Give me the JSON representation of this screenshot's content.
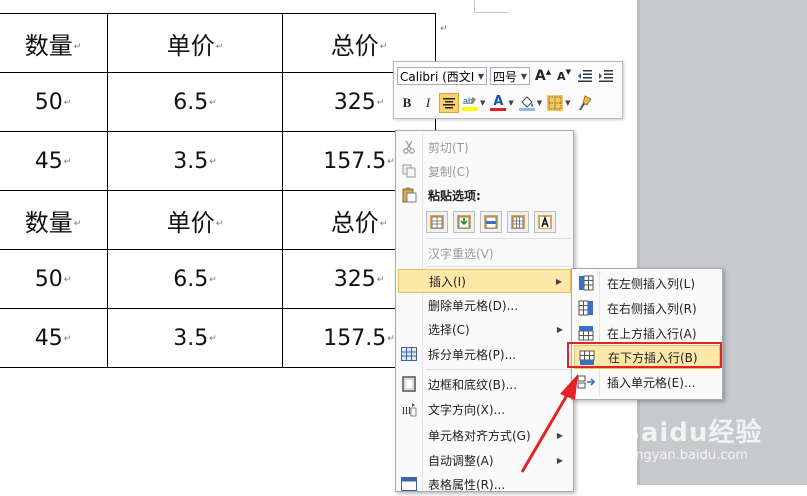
{
  "table": {
    "rows": [
      {
        "type": "head",
        "cells": [
          "数量",
          "单价",
          "总价"
        ]
      },
      {
        "type": "data",
        "cells": [
          "50",
          "6.5",
          "325"
        ]
      },
      {
        "type": "data",
        "cells": [
          "45",
          "3.5",
          "157.5"
        ]
      },
      {
        "type": "head",
        "cells": [
          "数量",
          "单价",
          "总价"
        ]
      },
      {
        "type": "data",
        "cells": [
          "50",
          "6.5",
          "325"
        ]
      },
      {
        "type": "data",
        "cells": [
          "45",
          "3.5",
          "157.5"
        ]
      }
    ],
    "paragraph_mark": "↵"
  },
  "mini_toolbar": {
    "font_name": "Calibri (西文Ⅰ",
    "font_size": "四号",
    "grow_font": "A",
    "shrink_font": "A",
    "bold": "B",
    "italic": "I",
    "font_color": "A"
  },
  "context_menu": {
    "cut": "剪切(T)",
    "copy": "复制(C)",
    "paste_options": "粘贴选项:",
    "reconvert": "汉字重选(V)",
    "insert": "插入(I)",
    "delete_cells": "删除单元格(D)...",
    "select": "选择(C)",
    "split_cells": "拆分单元格(P)...",
    "borders": "边框和底纹(B)...",
    "text_direction": "文字方向(X)...",
    "cell_alignment": "单元格对齐方式(G)",
    "autofit": "自动调整(A)",
    "table_properties": "表格属性(R)..."
  },
  "insert_submenu": {
    "insert_left": "在左侧插入列(L)",
    "insert_right": "在右侧插入列(R)",
    "insert_above": "在上方插入行(A)",
    "insert_below": "在下方插入行(B)",
    "insert_cells": "插入单元格(E)..."
  },
  "watermark": {
    "logo": "Baidu经验",
    "url": "jingyan.baidu.com"
  },
  "colors": {
    "highlight": "#fde8a8",
    "annotation_red": "#e32222",
    "font_color_red": "#e02020"
  }
}
